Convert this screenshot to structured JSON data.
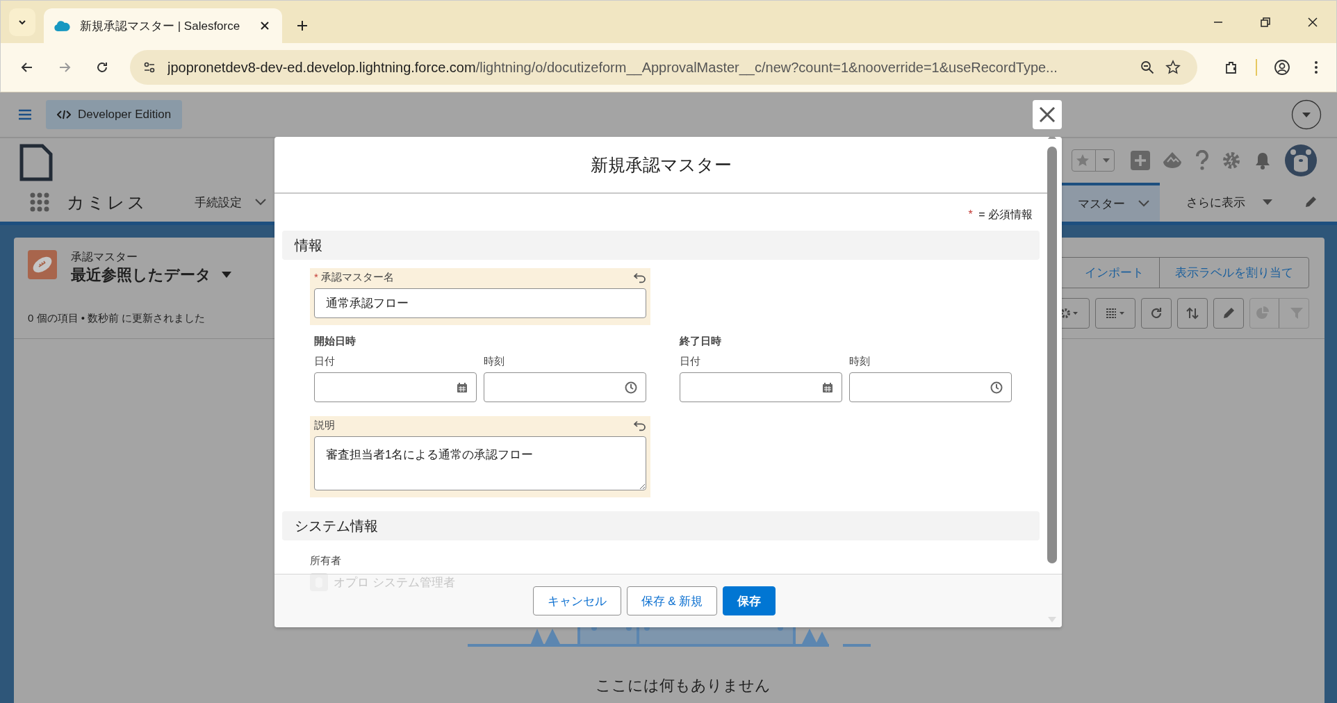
{
  "browser": {
    "tab": {
      "title": "新規承認マスター | Salesforce"
    },
    "url": {
      "host": "jpopronetdev8-dev-ed.develop.lightning.force.com",
      "path": "/lightning/o/docutizeform__ApprovalMaster__c/new?count=1&nooverride=1&useRecordType..."
    }
  },
  "header": {
    "badge": "Developer Edition"
  },
  "nav": {
    "app_name": "カミレス",
    "items": [
      {
        "label": "手続設定",
        "selected": false
      },
      {
        "label": "マスター",
        "selected": true
      }
    ],
    "more": "さらに表示"
  },
  "list": {
    "object": "承認マスター",
    "view": "最近参照したデータ",
    "status": "0 個の項目 • 数秒前 に更新されました",
    "buttons": [
      "インポート",
      "表示ラベルを割り当て"
    ],
    "empty_text": "ここには何もありません"
  },
  "modal": {
    "title": "新規承認マスター",
    "required_mark": "*",
    "required_note": "= 必須情報",
    "sections": [
      {
        "title": "情報"
      },
      {
        "title": "システム情報"
      }
    ],
    "name_field": {
      "label": "承認マスター名",
      "required": true,
      "value": "通常承認フロー"
    },
    "start": {
      "label": "開始日時",
      "date_label": "日付",
      "time_label": "時刻"
    },
    "end": {
      "label": "終了日時",
      "date_label": "日付",
      "time_label": "時刻"
    },
    "description": {
      "label": "説明",
      "value": "審査担当者1名による通常の承認フロー"
    },
    "owner": {
      "label": "所有者",
      "value": "オプロ システム管理者"
    },
    "buttons": [
      {
        "label": "キャンセル",
        "kind": "neutral"
      },
      {
        "label": "保存 & 新規",
        "kind": "neutral"
      },
      {
        "label": "保存",
        "kind": "brand"
      }
    ]
  }
}
